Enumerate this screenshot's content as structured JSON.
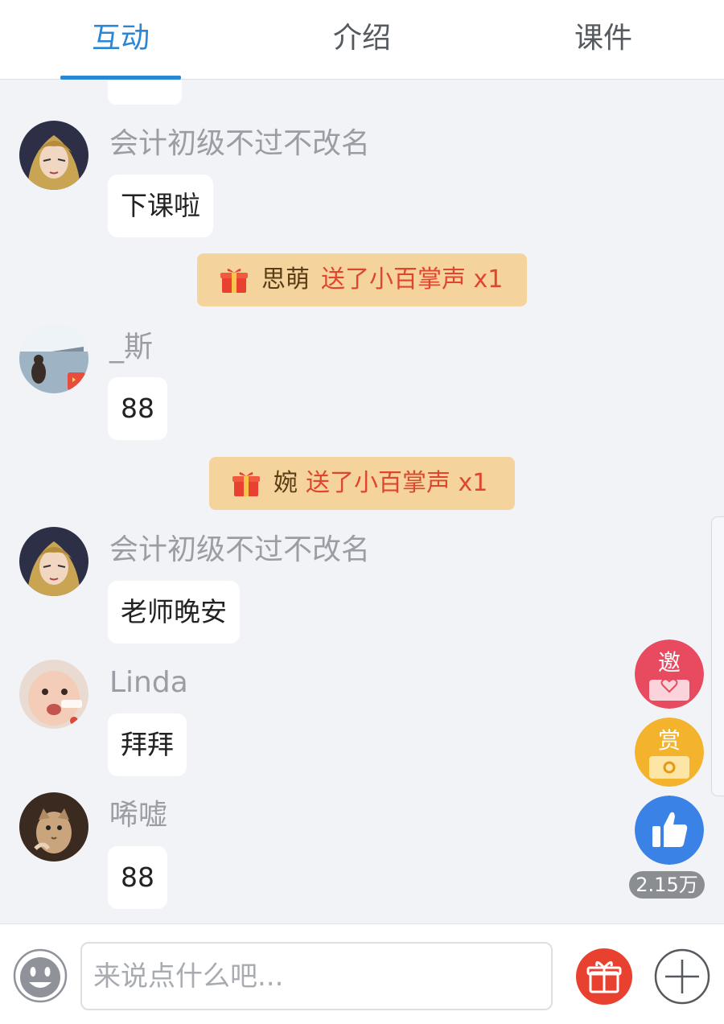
{
  "tabs": [
    {
      "label": "互动",
      "active": true
    },
    {
      "label": "介绍",
      "active": false
    },
    {
      "label": "课件",
      "active": false
    }
  ],
  "messages": [
    {
      "user": "会计初级不过不改名",
      "text": "下课啦",
      "avatar": "anime-girl-avatar"
    },
    {
      "gift": true,
      "giver": "思萌",
      "action": "送了小百掌声 x1"
    },
    {
      "user": "_斯",
      "text": "88",
      "avatar": "seaside-photo-avatar"
    },
    {
      "gift": true,
      "giver": "婉",
      "action": "送了小百掌声 x1"
    },
    {
      "user": "会计初级不过不改名",
      "text": "老师晚安",
      "avatar": "anime-girl-avatar"
    },
    {
      "user": "Linda",
      "text": "拜拜",
      "avatar": "baby-photo-avatar"
    },
    {
      "user": "唏嘘",
      "text": "88",
      "avatar": "cat-photo-avatar"
    }
  ],
  "floating": {
    "invite_label": "邀",
    "reward_label": "赏",
    "like_count": "2.15万"
  },
  "input": {
    "placeholder": "来说点什么吧..."
  },
  "colors": {
    "accent": "#2b87d3",
    "gift_banner_bg": "#f4d49c",
    "gift_action": "#e0452f",
    "invite": "#e84a5f",
    "reward": "#f3b32c",
    "like": "#3b82e6",
    "gift_button": "#e8412f"
  }
}
